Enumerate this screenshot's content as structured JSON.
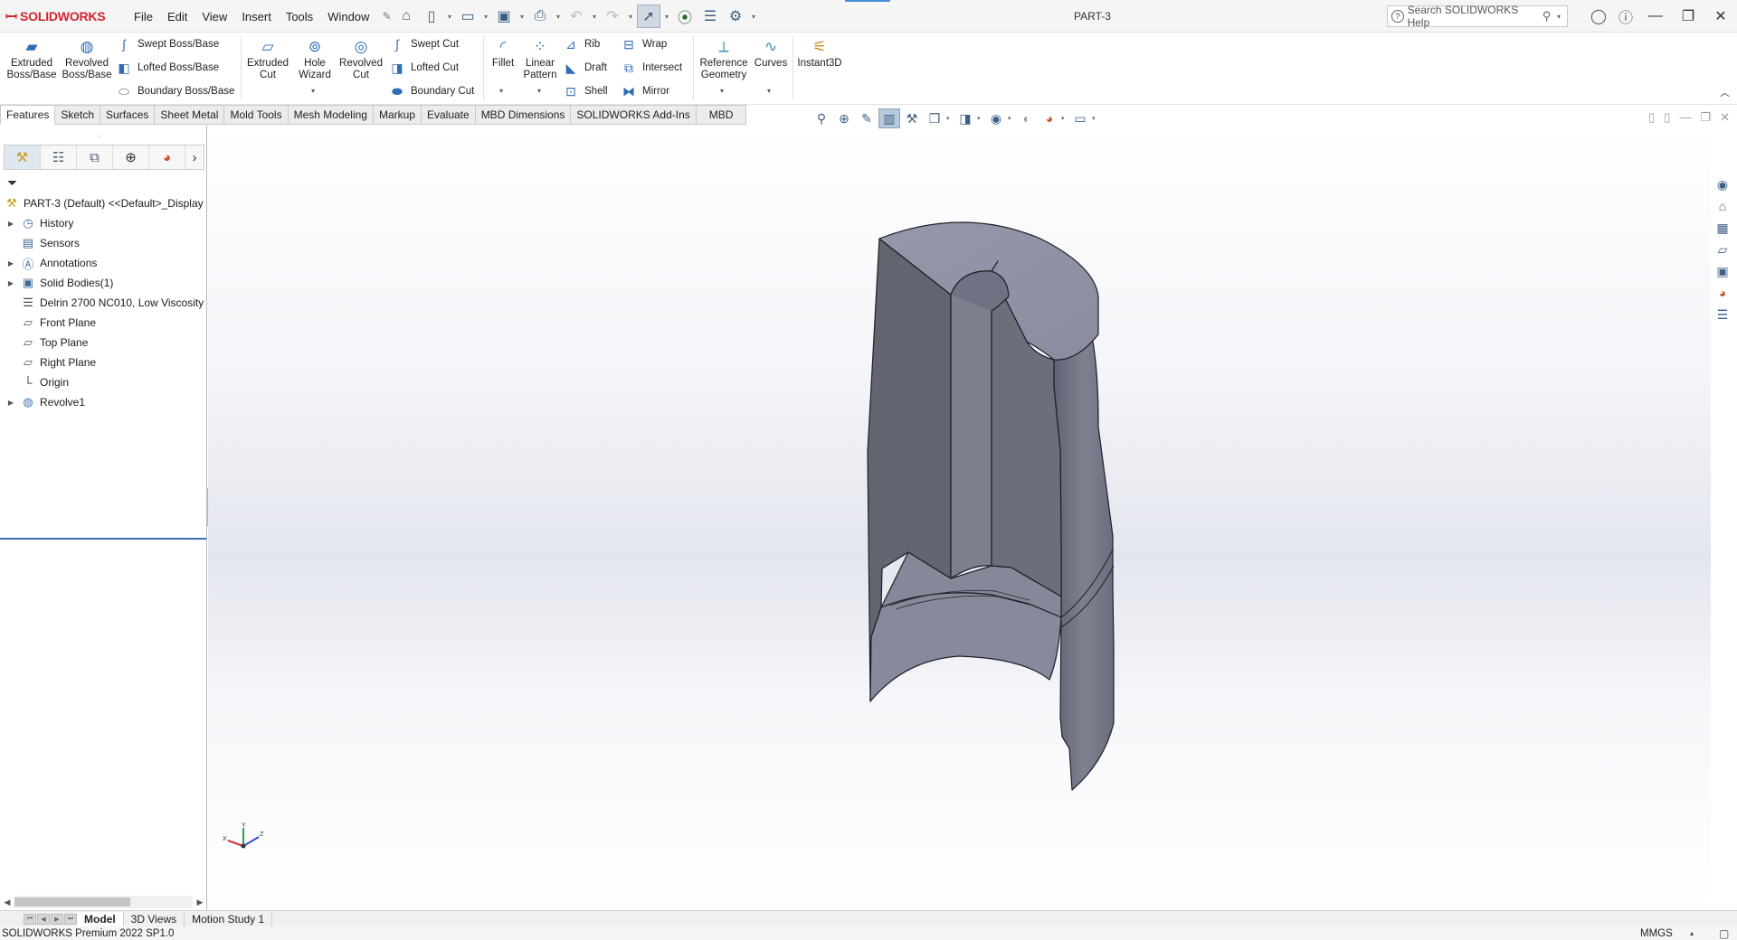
{
  "app": {
    "brand_ds": "3DS",
    "brand_name": "SOLIDWORKS",
    "document_title": "PART-3"
  },
  "menu": {
    "file": "File",
    "edit": "Edit",
    "view": "View",
    "insert": "Insert",
    "tools": "Tools",
    "window": "Window"
  },
  "search": {
    "placeholder": "Search SOLIDWORKS Help"
  },
  "ribbon": {
    "extruded_boss": "Extruded\nBoss/Base",
    "revolved_boss": "Revolved\nBoss/Base",
    "swept_boss": "Swept Boss/Base",
    "lofted_boss": "Lofted Boss/Base",
    "boundary_boss": "Boundary Boss/Base",
    "extruded_cut": "Extruded\nCut",
    "hole_wizard": "Hole\nWizard",
    "revolved_cut": "Revolved\nCut",
    "swept_cut": "Swept Cut",
    "lofted_cut": "Lofted Cut",
    "boundary_cut": "Boundary Cut",
    "fillet": "Fillet",
    "linear_pattern": "Linear\nPattern",
    "rib": "Rib",
    "draft": "Draft",
    "shell": "Shell",
    "wrap": "Wrap",
    "intersect": "Intersect",
    "mirror": "Mirror",
    "reference_geometry": "Reference\nGeometry",
    "curves": "Curves",
    "instant3d": "Instant3D"
  },
  "tabs": [
    "Features",
    "Sketch",
    "Surfaces",
    "Sheet Metal",
    "Mold Tools",
    "Mesh Modeling",
    "Markup",
    "Evaluate",
    "MBD Dimensions",
    "SOLIDWORKS Add-Ins",
    "MBD"
  ],
  "tree": {
    "root": "PART-3 (Default) <<Default>_Display",
    "history": "History",
    "sensors": "Sensors",
    "annotations": "Annotations",
    "solid_bodies": "Solid Bodies(1)",
    "material": "Delrin 2700 NC010, Low Viscosity",
    "front_plane": "Front Plane",
    "top_plane": "Top Plane",
    "right_plane": "Right Plane",
    "origin": "Origin",
    "revolve1": "Revolve1"
  },
  "triad": {
    "x": "X",
    "y": "Y",
    "z": "Z"
  },
  "bottom_tabs": {
    "model": "Model",
    "views3d": "3D Views",
    "motion": "Motion Study 1"
  },
  "status": {
    "version": "SOLIDWORKS Premium 2022 SP1.0",
    "units": "MMGS"
  },
  "colors": {
    "brand_red": "#d3242e",
    "model_gray": "#7b7f8c",
    "selection_blue": "#3b6fb1"
  }
}
